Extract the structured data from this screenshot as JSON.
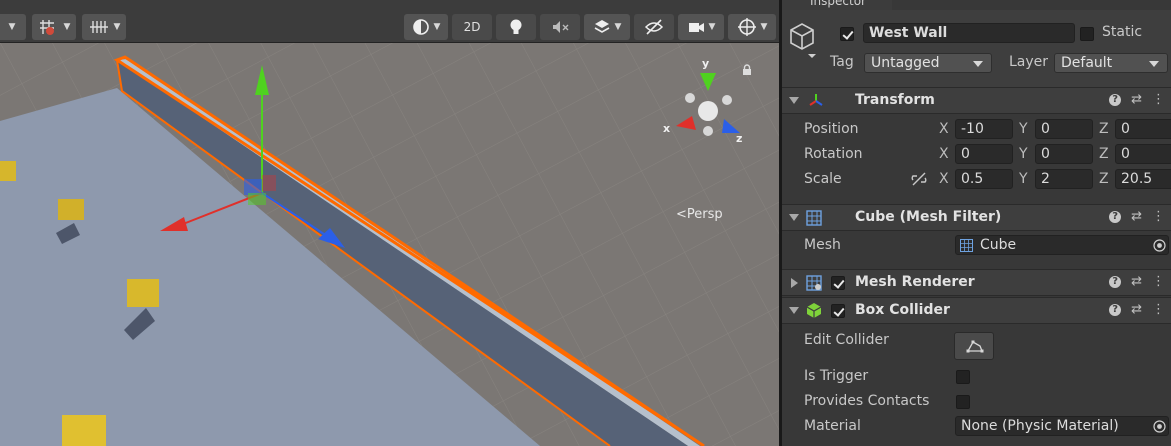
{
  "scene": {
    "toolbar": {
      "two_d_label": "2D"
    },
    "persp_label": "<Persp",
    "gizmo": {
      "x": "x",
      "y": "y",
      "z": "z"
    },
    "colors": {
      "selection_outline": "#ff6a00",
      "x_axis": "#e0302a",
      "y_axis": "#4fd21f",
      "z_axis": "#2b5fe8",
      "cube": "#d6b62c",
      "ground": "#8f9aae"
    }
  },
  "inspector": {
    "tab_label": "Inspector",
    "object": {
      "name": "West Wall",
      "active": true,
      "static_label": "Static",
      "static": false,
      "tag_label": "Tag",
      "tag_value": "Untagged",
      "layer_label": "Layer",
      "layer_value": "Default"
    },
    "transform": {
      "title": "Transform",
      "rows": [
        {
          "label": "Position",
          "x": "-10",
          "y": "0",
          "z": "0"
        },
        {
          "label": "Rotation",
          "x": "0",
          "y": "0",
          "z": "0"
        },
        {
          "label": "Scale",
          "x": "0.5",
          "y": "2",
          "z": "20.5"
        }
      ],
      "axes": {
        "x": "X",
        "y": "Y",
        "z": "Z"
      }
    },
    "mesh_filter": {
      "title": "Cube (Mesh Filter)",
      "mesh_label": "Mesh",
      "mesh_value": "Cube"
    },
    "mesh_renderer": {
      "title": "Mesh Renderer",
      "enabled": true
    },
    "box_collider": {
      "title": "Box Collider",
      "enabled": true,
      "edit_collider_label": "Edit Collider",
      "is_trigger_label": "Is Trigger",
      "provides_contacts_label": "Provides Contacts",
      "material_label": "Material",
      "material_value": "None (Physic Material)"
    }
  }
}
